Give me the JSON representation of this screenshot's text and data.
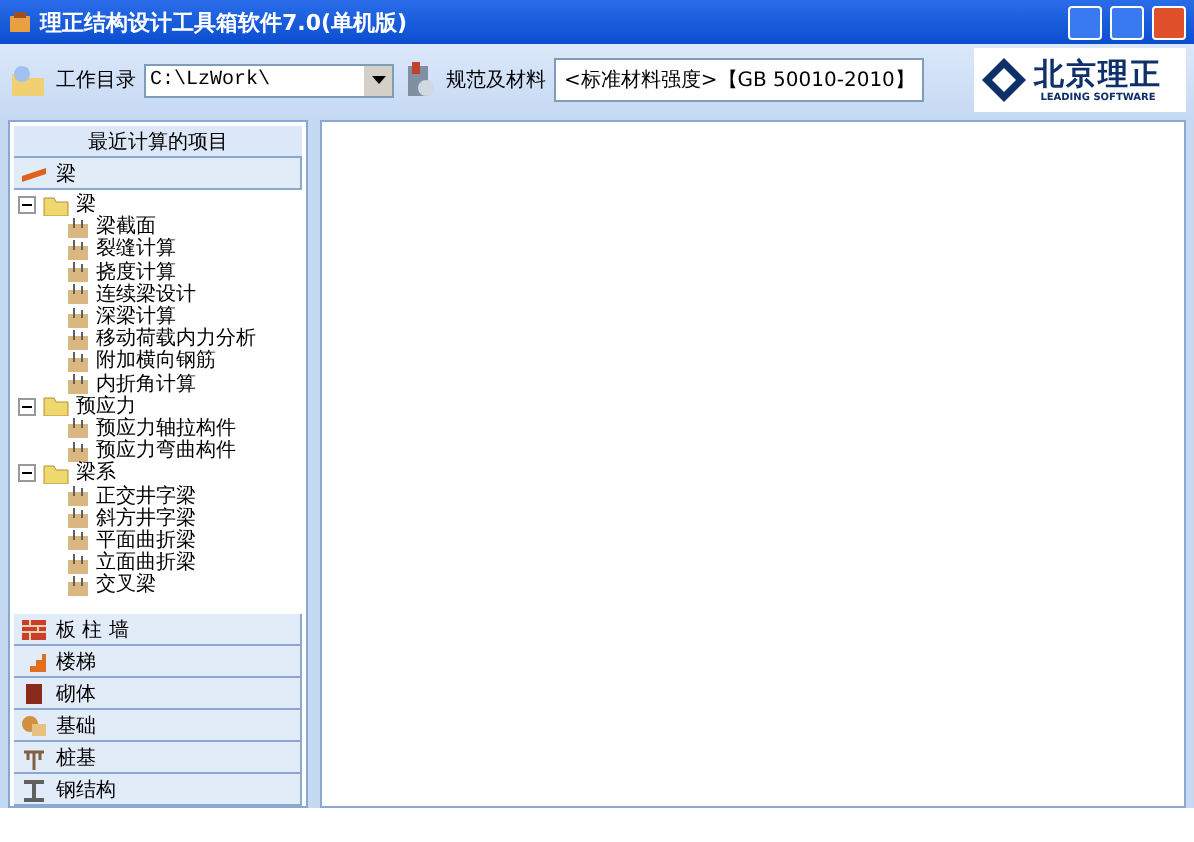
{
  "window": {
    "title": "理正结构设计工具箱软件7.0(单机版)"
  },
  "toolbar": {
    "workdir_label": "工作目录",
    "workdir_value": "C:\\LzWork\\",
    "standard_label": "规范及材料",
    "standard_value": "<标准材料强度>【GB 50010-2010】",
    "logo_text": "北京理正",
    "logo_subtext": "LEADING SOFTWARE"
  },
  "sidebar": {
    "recent_header": "最近计算的项目",
    "active_category": "梁",
    "tree": [
      {
        "label": "梁",
        "expanded": true,
        "children": [
          {
            "label": "梁截面"
          },
          {
            "label": "裂缝计算"
          },
          {
            "label": "挠度计算"
          },
          {
            "label": "连续梁设计"
          },
          {
            "label": "深梁计算"
          },
          {
            "label": "移动荷载内力分析"
          },
          {
            "label": "附加横向钢筋"
          },
          {
            "label": "内折角计算"
          }
        ]
      },
      {
        "label": "预应力",
        "expanded": true,
        "children": [
          {
            "label": "预应力轴拉构件"
          },
          {
            "label": "预应力弯曲构件"
          }
        ]
      },
      {
        "label": "梁系",
        "expanded": true,
        "children": [
          {
            "label": "正交井字梁"
          },
          {
            "label": "斜方井字梁"
          },
          {
            "label": "平面曲折梁"
          },
          {
            "label": "立面曲折梁"
          },
          {
            "label": "交叉梁"
          }
        ]
      }
    ],
    "categories": [
      {
        "label": "板 柱 墙",
        "kind": "slab"
      },
      {
        "label": "楼梯",
        "kind": "stair"
      },
      {
        "label": "砌体",
        "kind": "masonry"
      },
      {
        "label": "基础",
        "kind": "foundation"
      },
      {
        "label": "桩基",
        "kind": "pile"
      },
      {
        "label": "钢结构",
        "kind": "steel"
      }
    ]
  }
}
